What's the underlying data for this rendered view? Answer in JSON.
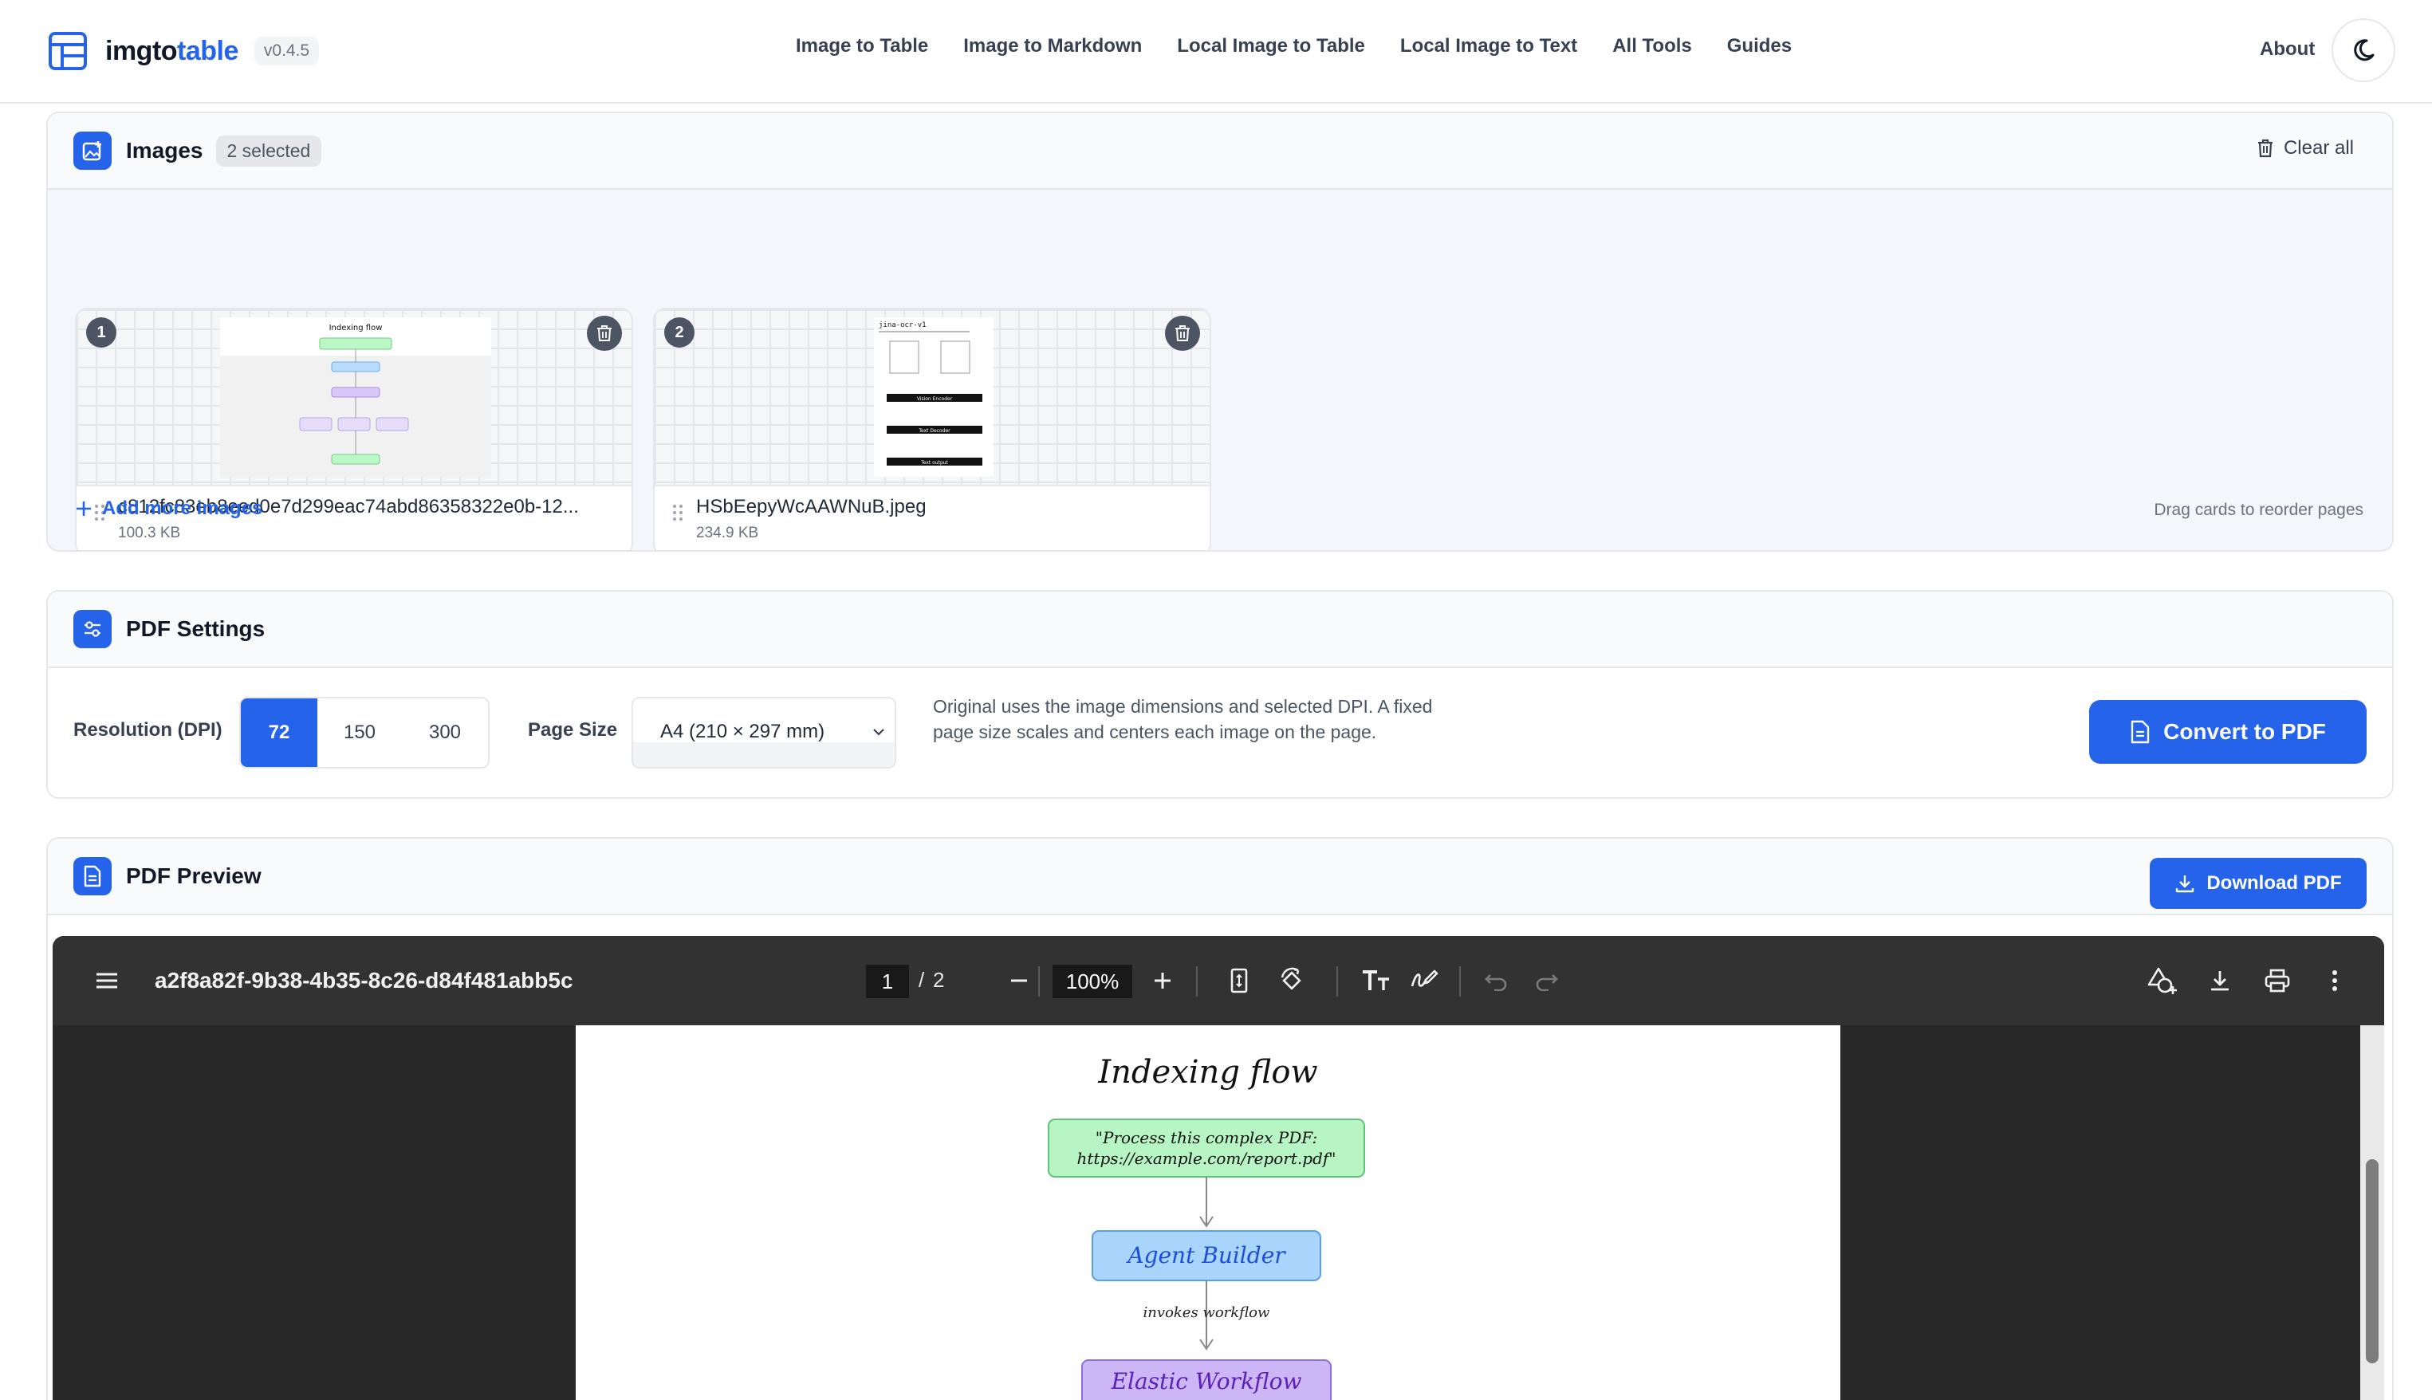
{
  "app": {
    "brand_prefix": "imgto",
    "brand_suffix": "table",
    "version": "v0.4.5",
    "accent_color": "#2563eb"
  },
  "nav": {
    "links": [
      "Image to Table",
      "Image to Markdown",
      "Local Image to Table",
      "Local Image to Text",
      "All Tools",
      "Guides"
    ],
    "about": "About",
    "theme_icon": "moon-icon"
  },
  "images": {
    "title": "Images",
    "selected_badge": "2 selected",
    "clear_all": "Clear all",
    "items": [
      {
        "index": "1",
        "filename": "c812fc83eb8eed0e7d299eac74abd86358322e0b-12...",
        "size": "100.3 KB"
      },
      {
        "index": "2",
        "filename": "HSbEepyWcAAWNuB.jpeg",
        "size": "234.9 KB"
      }
    ],
    "add_more": "Add more images",
    "drag_hint": "Drag cards to reorder pages"
  },
  "settings": {
    "title": "PDF Settings",
    "resolution_label": "Resolution (DPI)",
    "dpi_options": [
      "72",
      "150",
      "300"
    ],
    "dpi_selected": "72",
    "page_size_label": "Page Size",
    "page_size_value": "A4 (210 × 297 mm)",
    "help_text": "Original uses the image dimensions and selected DPI. A fixed page size scales and centers each image on the page.",
    "convert_button": "Convert to PDF"
  },
  "preview": {
    "title": "PDF Preview",
    "download_button": "Download PDF",
    "viewer": {
      "document_title": "a2f8a82f-9b38-4b35-8c26-d84f481abb5c",
      "current_page": "1",
      "page_separator": "/",
      "total_pages": "2",
      "zoom": "100%"
    },
    "page_content": {
      "heading": "Indexing flow",
      "input_line1": "\"Process this complex PDF:",
      "input_line2": "https://example.com/report.pdf\"",
      "agent": "Agent Builder",
      "edge_label": "invokes workflow",
      "workflow": "Elastic Workflow"
    }
  },
  "thumbnail_2": {
    "title": "jina-ocr-v1",
    "block_labels": [
      "Vision Encoder",
      "Text Decoder",
      "Text output"
    ]
  }
}
